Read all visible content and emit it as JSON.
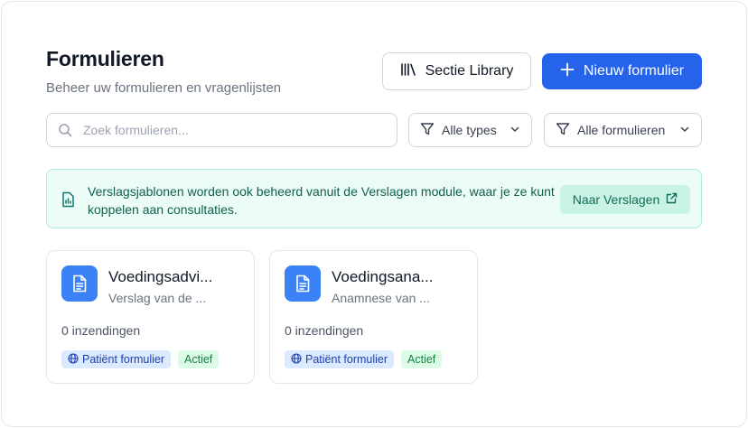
{
  "header": {
    "title": "Formulieren",
    "subtitle": "Beheer uw formulieren en vragenlijsten",
    "library_button": "Sectie Library",
    "new_button": "Nieuw formulier"
  },
  "filters": {
    "search_placeholder": "Zoek formulieren...",
    "type_select": "Alle types",
    "form_select": "Alle formulieren"
  },
  "banner": {
    "text": "Verslagsjablonen worden ook beheerd vanuit de Verslagen module, waar je ze kunt koppelen aan consultaties.",
    "link_label": "Naar Verslagen"
  },
  "cards": [
    {
      "title": "Voedingsadvi...",
      "description": "Verslag van de ...",
      "submissions": "0 inzendingen",
      "type_badge": "Patiënt formulier",
      "status_badge": "Actief"
    },
    {
      "title": "Voedingsana...",
      "description": "Anamnese van ...",
      "submissions": "0 inzendingen",
      "type_badge": "Patiënt formulier",
      "status_badge": "Actief"
    }
  ],
  "colors": {
    "primary": "#2563eb",
    "card_icon": "#3b82f6",
    "banner_bg": "#ecfdf8",
    "banner_text": "#0f5f4c",
    "badge_type_bg": "#dbeafe",
    "badge_status_bg": "#dcfce7"
  },
  "icons": {
    "library": "library-icon",
    "new": "plus-icon",
    "search": "search-icon",
    "filter": "filter-icon",
    "chevron": "chevron-down-icon",
    "banner": "report-icon",
    "external": "external-link-icon",
    "card": "document-icon",
    "globe": "globe-icon"
  }
}
